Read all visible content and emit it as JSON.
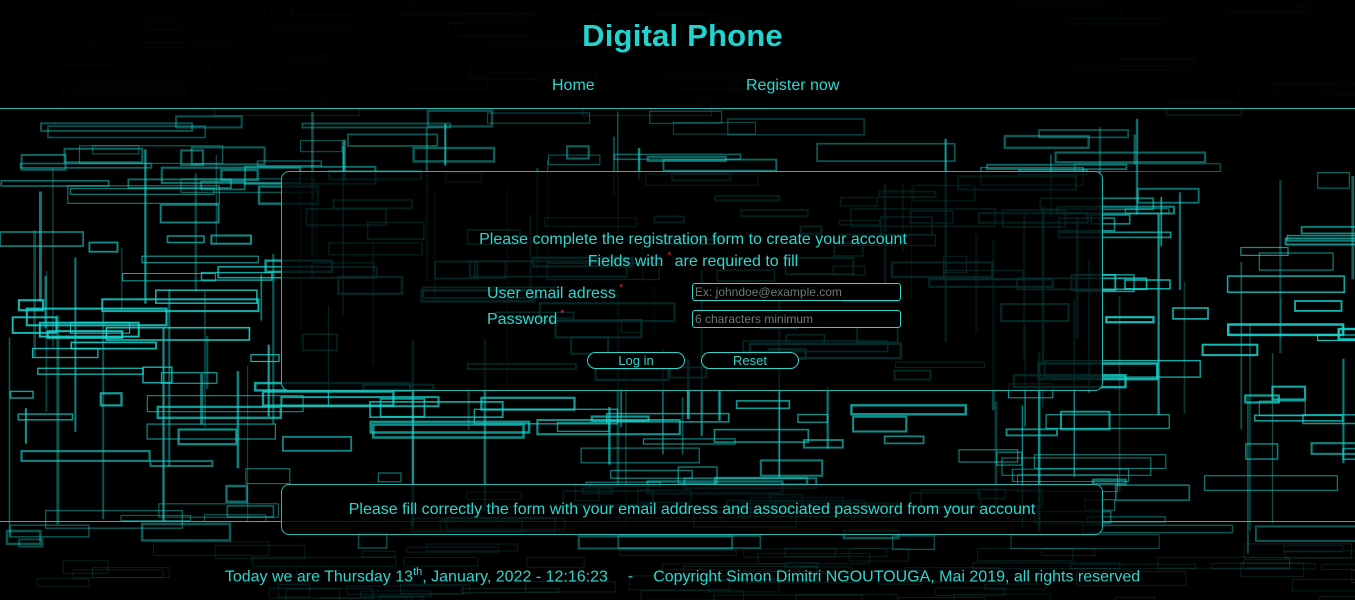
{
  "site": {
    "title": "Digital Phone"
  },
  "nav": {
    "home": "Home",
    "register": "Register now"
  },
  "form": {
    "intro_line1": "Please complete the registration form to create your account",
    "intro_line2_before": "Fields with",
    "required_marker": "*",
    "intro_line2_after": "are required to fill",
    "email_label": "User email adress",
    "email_placeholder": "Ex: johndoe@example.com",
    "email_value": "",
    "password_label": "Password",
    "password_placeholder": "6 characters minimum",
    "password_value": "",
    "login_button": "Log in",
    "reset_button": "Reset"
  },
  "info": {
    "message": "Please fill correctly the form with your email address and associated password from your account"
  },
  "footer": {
    "date_prefix": "Today we are Thursday 13",
    "date_suffix_sup": "th",
    "date_rest": ", January, 2022 - 12:16:23",
    "separator": "-",
    "copyright": "Copyright Simon Dimitri NGOUTOUGA, Mai 2019, all rights reserved"
  },
  "colors": {
    "accent": "#2fd6cf",
    "title": "#22d3cf",
    "required": "#d9232b",
    "background": "#000000"
  }
}
